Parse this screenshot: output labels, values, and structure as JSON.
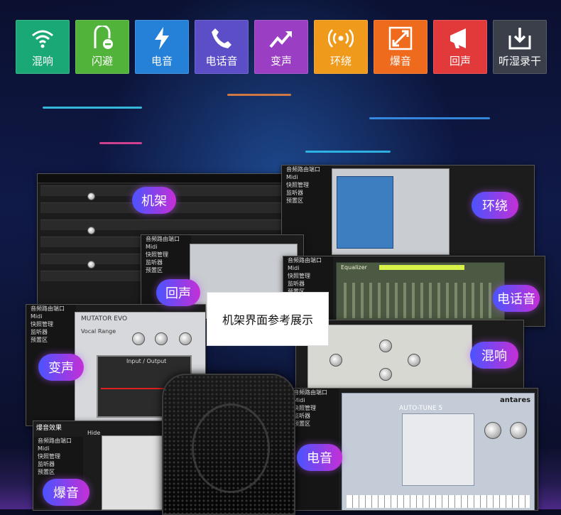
{
  "fx_buttons": [
    {
      "label": "混响",
      "icon": "wifi-icon",
      "color": "#1aa876"
    },
    {
      "label": "闪避",
      "icon": "dodge-icon",
      "color": "#52b33a"
    },
    {
      "label": "电音",
      "icon": "lightning-icon",
      "color": "#2581d8"
    },
    {
      "label": "电话音",
      "icon": "phone-icon",
      "color": "#5b4ec6"
    },
    {
      "label": "变声",
      "icon": "trend-arrow-icon",
      "color": "#9a3fc4"
    },
    {
      "label": "环绕",
      "icon": "surround-icon",
      "color": "#f09a1c"
    },
    {
      "label": "爆音",
      "icon": "expand-arrows-icon",
      "color": "#ee6a1c"
    },
    {
      "label": "回声",
      "icon": "megaphone-icon",
      "color": "#e23a3a"
    },
    {
      "label": "听湿录干",
      "icon": "download-box-icon",
      "color": "#3a3f4a"
    }
  ],
  "labels": {
    "jijia": "机架",
    "huanrao": "环绕",
    "huisheng": "回声",
    "dianhuayin": "电话音",
    "biansheng": "变声",
    "hunxiang": "混响",
    "dianyin": "电音",
    "baoyin": "爆音"
  },
  "caption": "机架界面参考展示",
  "rack_menu": [
    "音频路由端口",
    "Midi",
    "快照管理",
    "监听器",
    "预置区"
  ],
  "plugin_titles": {
    "equalizer": "Equalizer",
    "mutator": "MUTATOR EVO",
    "mutator_panel": "Input / Output",
    "vocal_range": "Vocal Range",
    "antares": "antares",
    "autotune": "AUTO-TUNE 5",
    "hide": "Hide",
    "baoyin_title": "爆音效果"
  }
}
